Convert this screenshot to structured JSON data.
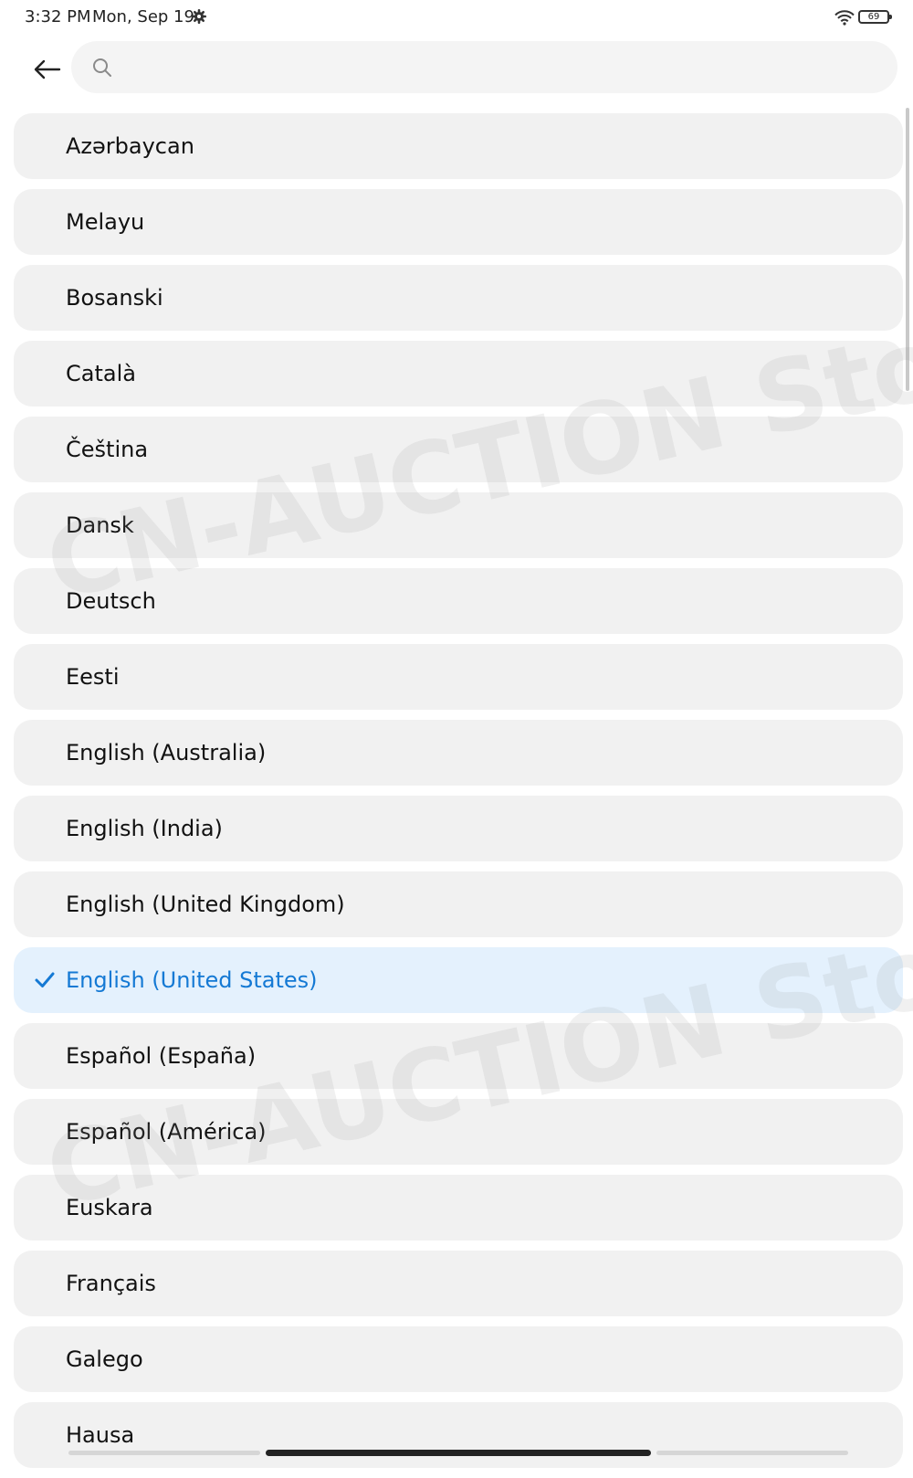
{
  "status_bar": {
    "time": "3:32 PM",
    "date": "Mon, Sep 19",
    "battery": "69",
    "settings_icon": "gear-icon",
    "wifi_icon": "wifi-icon"
  },
  "header": {
    "back_icon": "back-arrow-icon",
    "search": {
      "placeholder": "",
      "value": "",
      "icon": "search-icon"
    }
  },
  "languages": [
    {
      "label": "Azərbaycan",
      "selected": false
    },
    {
      "label": "Melayu",
      "selected": false
    },
    {
      "label": "Bosanski",
      "selected": false
    },
    {
      "label": "Català",
      "selected": false
    },
    {
      "label": "Čeština",
      "selected": false
    },
    {
      "label": "Dansk",
      "selected": false
    },
    {
      "label": "Deutsch",
      "selected": false
    },
    {
      "label": "Eesti",
      "selected": false
    },
    {
      "label": "English (Australia)",
      "selected": false
    },
    {
      "label": "English (India)",
      "selected": false
    },
    {
      "label": "English (United Kingdom)",
      "selected": false
    },
    {
      "label": "English (United States)",
      "selected": true
    },
    {
      "label": "Español (España)",
      "selected": false
    },
    {
      "label": "Español (América)",
      "selected": false
    },
    {
      "label": "Euskara",
      "selected": false
    },
    {
      "label": "Français",
      "selected": false
    },
    {
      "label": "Galego",
      "selected": false
    },
    {
      "label": "Hausa",
      "selected": false
    }
  ],
  "watermark": "CN-AUCTION Store",
  "colors": {
    "selected_text": "#1479d4",
    "selected_bg": "#e4f1fd",
    "item_bg": "#f1f1f1"
  }
}
